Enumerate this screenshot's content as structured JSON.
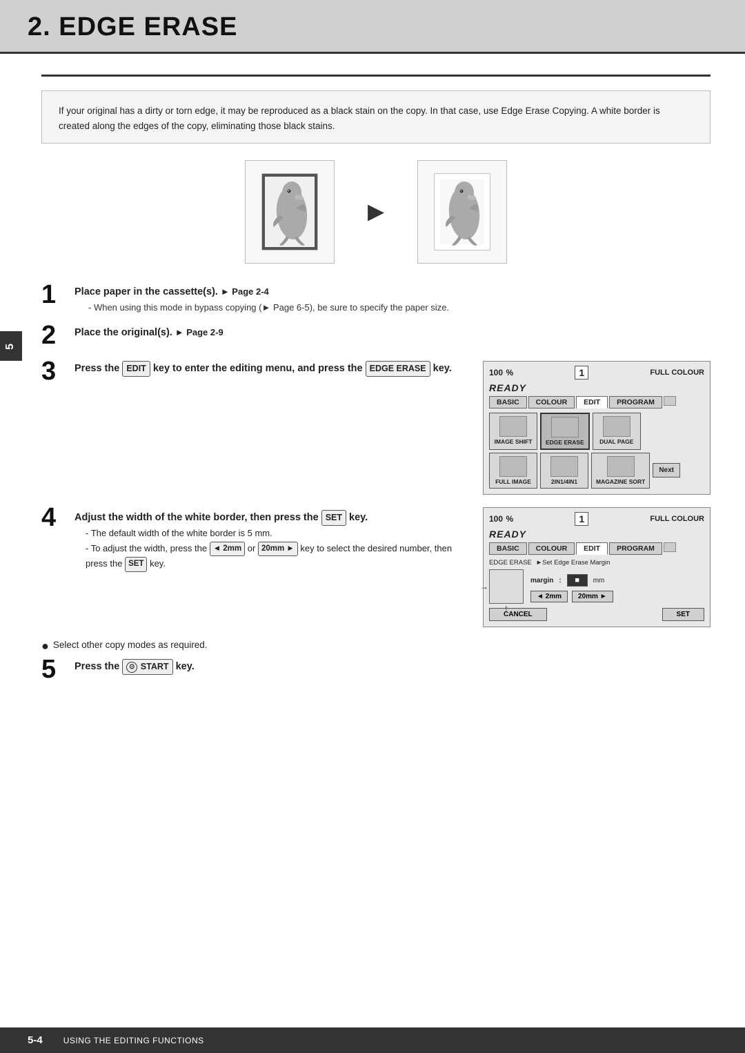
{
  "page": {
    "title": "2. EDGE ERASE",
    "side_tab": "5",
    "footer_page": "5-4",
    "footer_text": "USING THE EDITING FUNCTIONS"
  },
  "intro": {
    "text": "If your original has a dirty or torn edge, it may be reproduced as a black stain on the copy. In that case, use Edge Erase Copying. A white border is created along the edges of the copy, eliminating those black stains."
  },
  "steps": [
    {
      "number": "1",
      "main": "Place paper in the cassette(s).",
      "ref": "► Page 2-4",
      "sub": [
        "When using this mode in bypass copying (► Page 6-5), be sure to specify the paper size."
      ]
    },
    {
      "number": "2",
      "main": "Place the original(s).",
      "ref": "► Page 2-9",
      "sub": []
    },
    {
      "number": "3",
      "main": "Press the EDIT key to enter the editing menu, and press the EDGE ERASE key.",
      "ref": "",
      "sub": []
    },
    {
      "number": "4",
      "main": "Adjust the width of the white border, then press the SET key.",
      "ref": "",
      "sub": [
        "The default width of the white border is 5 mm.",
        "To adjust the width, press the ◄ 2mm or 20mm ► key to select the desired number, then press the SET key."
      ]
    },
    {
      "number": "5",
      "main": "Press the",
      "start_key": "⊙ START",
      "end": "key.",
      "sub": []
    }
  ],
  "bullet_note": "Select other copy modes as required.",
  "ui_panel_1": {
    "percent": "100",
    "percent_sym": "%",
    "count": "1",
    "colour": "FULL COLOUR",
    "ready": "READY",
    "tabs": [
      "BASIC",
      "COLOUR",
      "EDIT",
      "PROGRAM"
    ],
    "buttons_row1": [
      {
        "label": "IMAGE SHIFT"
      },
      {
        "label": "EDGE ERASE",
        "highlighted": true
      },
      {
        "label": "DUAL PAGE"
      }
    ],
    "buttons_row2": [
      {
        "label": "FULL IMAGE"
      },
      {
        "label": "2IN1/4IN1"
      },
      {
        "label": "MAGAZINE SORT"
      }
    ],
    "next_label": "Next"
  },
  "ui_panel_2": {
    "percent": "100",
    "percent_sym": "%",
    "count": "1",
    "colour": "FULL COLOUR",
    "ready": "READY",
    "tabs": [
      "BASIC",
      "COLOUR",
      "EDIT",
      "PROGRAM"
    ],
    "breadcrumb": "EDGE ERASE",
    "breadcrumb_sub": "►Set Edge Erase Margin",
    "margin_label": "margin",
    "margin_colon": ":",
    "margin_value": "■",
    "margin_unit": "mm",
    "btn_2mm": "◄ 2mm",
    "btn_20mm": "20mm ►",
    "cancel_label": "CANCEL",
    "set_label": "SET"
  }
}
